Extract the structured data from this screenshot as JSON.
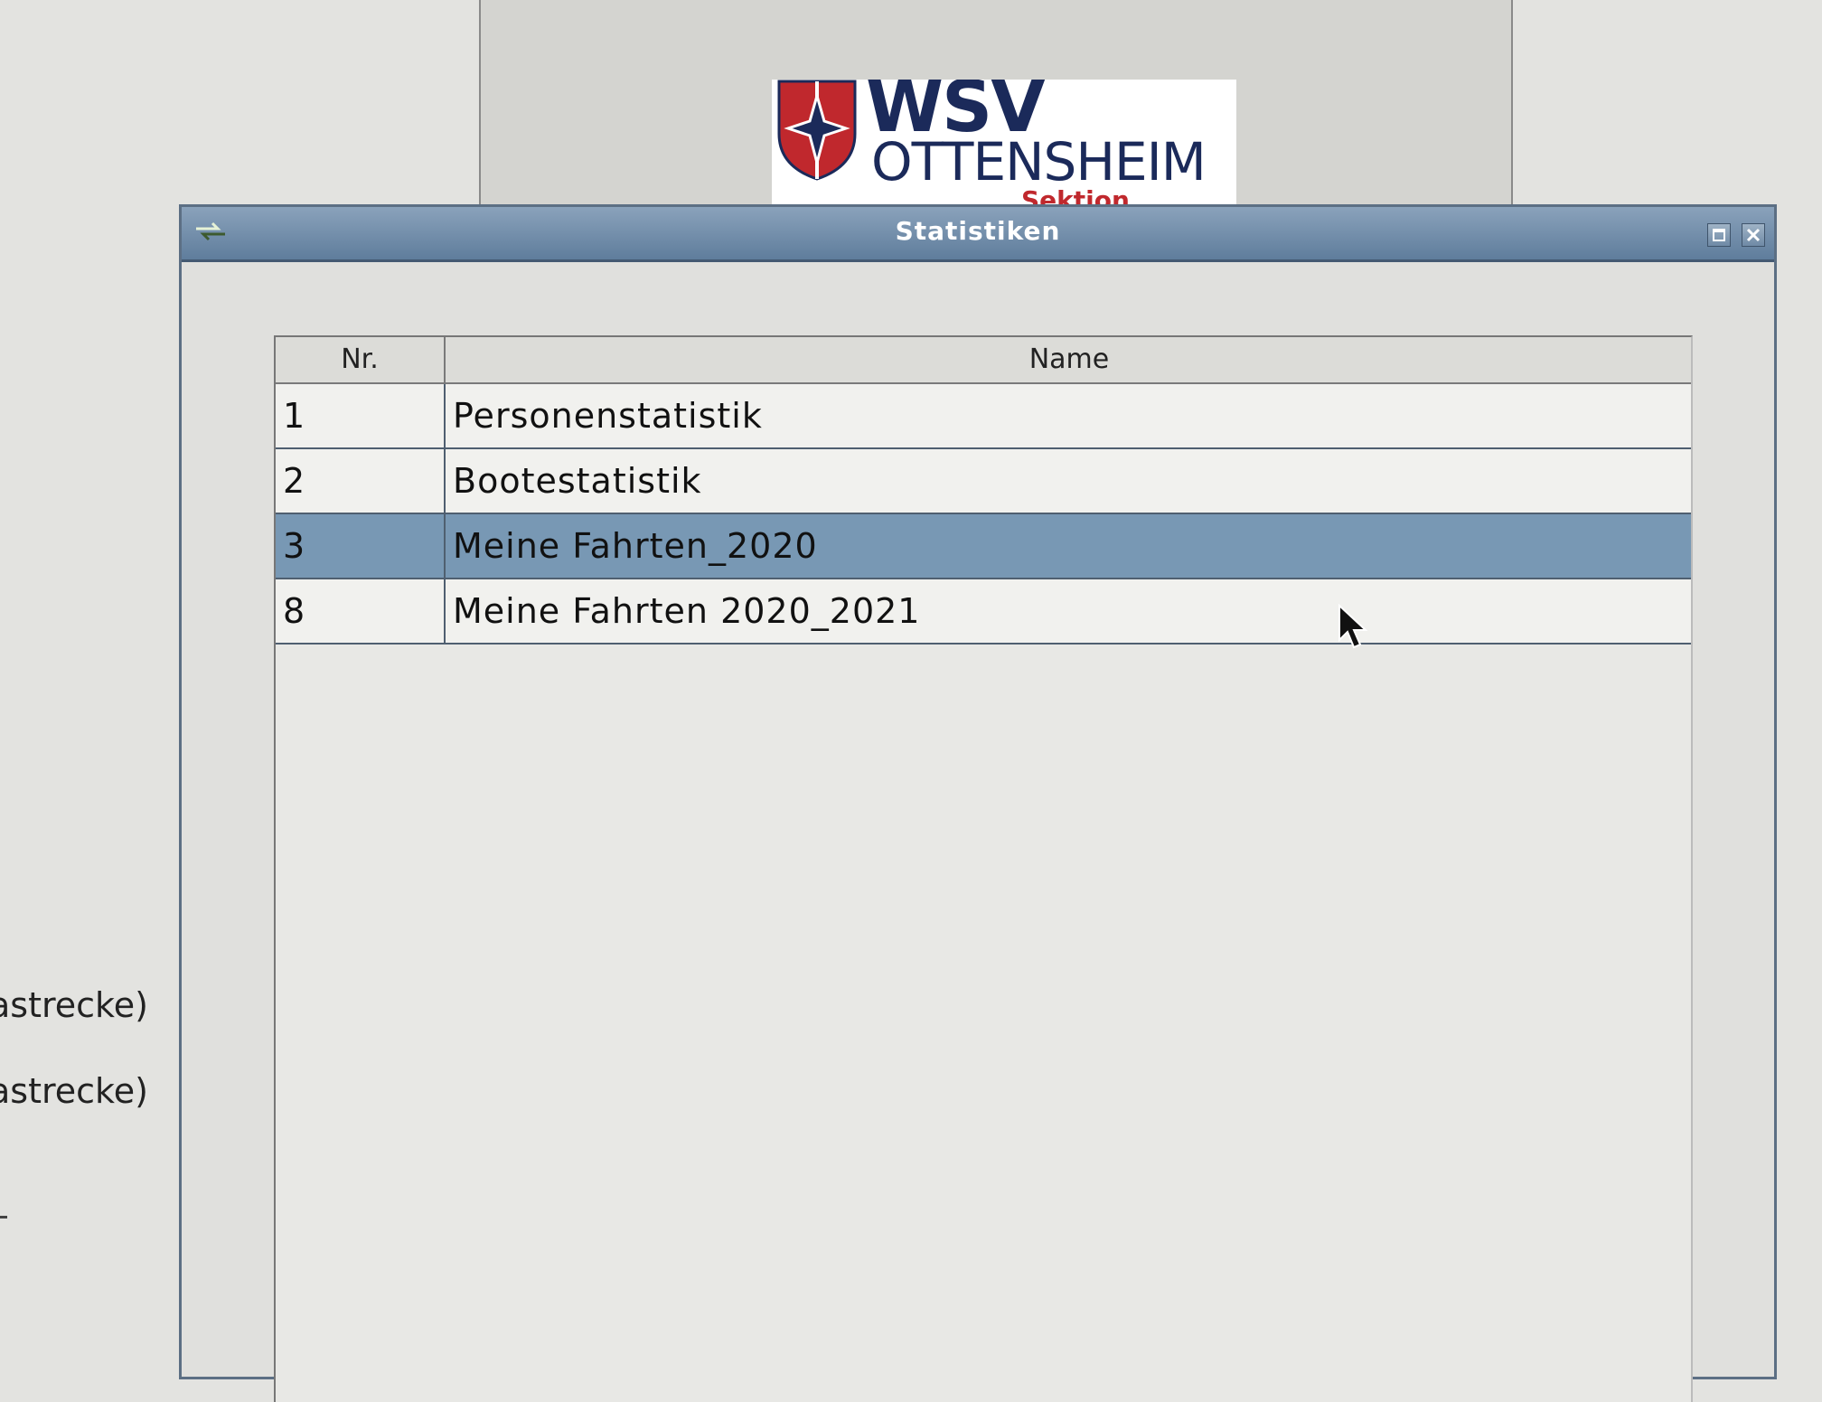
{
  "background": {
    "text_lines": [
      "astrecke)",
      "astrecke)"
    ]
  },
  "logo": {
    "brand": "WSV",
    "city": "OTTENSHEIM",
    "section": "Sektion Rudern",
    "colors": {
      "navy": "#1b2a5a",
      "red": "#c0282d"
    }
  },
  "dialog": {
    "title": "Statistiken",
    "icon": "app-arrows-icon",
    "buttons": {
      "maximize_icon": "maximize-icon",
      "close_icon": "close-icon"
    },
    "table": {
      "columns": [
        "Nr.",
        "Name"
      ],
      "rows": [
        {
          "nr": "1",
          "name": "Personenstatistik",
          "selected": false
        },
        {
          "nr": "2",
          "name": "Bootestatistik",
          "selected": false
        },
        {
          "nr": "3",
          "name": "Meine Fahrten_2020",
          "selected": true
        },
        {
          "nr": "8",
          "name": "Meine Fahrten 2020_2021",
          "selected": false
        }
      ]
    },
    "colors": {
      "titlebar": "#5f7d9c",
      "selection": "#7898b4"
    }
  }
}
